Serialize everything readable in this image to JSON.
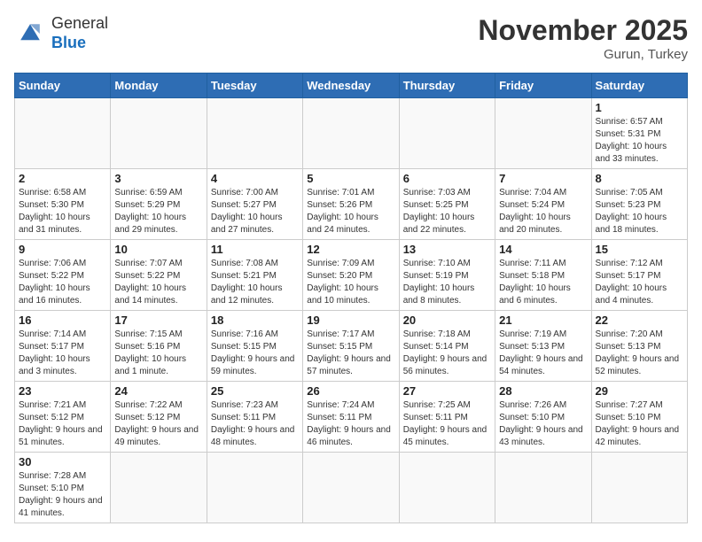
{
  "logo": {
    "general": "General",
    "blue": "Blue"
  },
  "title": "November 2025",
  "location": "Gurun, Turkey",
  "days_of_week": [
    "Sunday",
    "Monday",
    "Tuesday",
    "Wednesday",
    "Thursday",
    "Friday",
    "Saturday"
  ],
  "weeks": [
    [
      {
        "day": "",
        "info": ""
      },
      {
        "day": "",
        "info": ""
      },
      {
        "day": "",
        "info": ""
      },
      {
        "day": "",
        "info": ""
      },
      {
        "day": "",
        "info": ""
      },
      {
        "day": "",
        "info": ""
      },
      {
        "day": "1",
        "info": "Sunrise: 6:57 AM\nSunset: 5:31 PM\nDaylight: 10 hours and 33 minutes."
      }
    ],
    [
      {
        "day": "2",
        "info": "Sunrise: 6:58 AM\nSunset: 5:30 PM\nDaylight: 10 hours and 31 minutes."
      },
      {
        "day": "3",
        "info": "Sunrise: 6:59 AM\nSunset: 5:29 PM\nDaylight: 10 hours and 29 minutes."
      },
      {
        "day": "4",
        "info": "Sunrise: 7:00 AM\nSunset: 5:27 PM\nDaylight: 10 hours and 27 minutes."
      },
      {
        "day": "5",
        "info": "Sunrise: 7:01 AM\nSunset: 5:26 PM\nDaylight: 10 hours and 24 minutes."
      },
      {
        "day": "6",
        "info": "Sunrise: 7:03 AM\nSunset: 5:25 PM\nDaylight: 10 hours and 22 minutes."
      },
      {
        "day": "7",
        "info": "Sunrise: 7:04 AM\nSunset: 5:24 PM\nDaylight: 10 hours and 20 minutes."
      },
      {
        "day": "8",
        "info": "Sunrise: 7:05 AM\nSunset: 5:23 PM\nDaylight: 10 hours and 18 minutes."
      }
    ],
    [
      {
        "day": "9",
        "info": "Sunrise: 7:06 AM\nSunset: 5:22 PM\nDaylight: 10 hours and 16 minutes."
      },
      {
        "day": "10",
        "info": "Sunrise: 7:07 AM\nSunset: 5:22 PM\nDaylight: 10 hours and 14 minutes."
      },
      {
        "day": "11",
        "info": "Sunrise: 7:08 AM\nSunset: 5:21 PM\nDaylight: 10 hours and 12 minutes."
      },
      {
        "day": "12",
        "info": "Sunrise: 7:09 AM\nSunset: 5:20 PM\nDaylight: 10 hours and 10 minutes."
      },
      {
        "day": "13",
        "info": "Sunrise: 7:10 AM\nSunset: 5:19 PM\nDaylight: 10 hours and 8 minutes."
      },
      {
        "day": "14",
        "info": "Sunrise: 7:11 AM\nSunset: 5:18 PM\nDaylight: 10 hours and 6 minutes."
      },
      {
        "day": "15",
        "info": "Sunrise: 7:12 AM\nSunset: 5:17 PM\nDaylight: 10 hours and 4 minutes."
      }
    ],
    [
      {
        "day": "16",
        "info": "Sunrise: 7:14 AM\nSunset: 5:17 PM\nDaylight: 10 hours and 3 minutes."
      },
      {
        "day": "17",
        "info": "Sunrise: 7:15 AM\nSunset: 5:16 PM\nDaylight: 10 hours and 1 minute."
      },
      {
        "day": "18",
        "info": "Sunrise: 7:16 AM\nSunset: 5:15 PM\nDaylight: 9 hours and 59 minutes."
      },
      {
        "day": "19",
        "info": "Sunrise: 7:17 AM\nSunset: 5:15 PM\nDaylight: 9 hours and 57 minutes."
      },
      {
        "day": "20",
        "info": "Sunrise: 7:18 AM\nSunset: 5:14 PM\nDaylight: 9 hours and 56 minutes."
      },
      {
        "day": "21",
        "info": "Sunrise: 7:19 AM\nSunset: 5:13 PM\nDaylight: 9 hours and 54 minutes."
      },
      {
        "day": "22",
        "info": "Sunrise: 7:20 AM\nSunset: 5:13 PM\nDaylight: 9 hours and 52 minutes."
      }
    ],
    [
      {
        "day": "23",
        "info": "Sunrise: 7:21 AM\nSunset: 5:12 PM\nDaylight: 9 hours and 51 minutes."
      },
      {
        "day": "24",
        "info": "Sunrise: 7:22 AM\nSunset: 5:12 PM\nDaylight: 9 hours and 49 minutes."
      },
      {
        "day": "25",
        "info": "Sunrise: 7:23 AM\nSunset: 5:11 PM\nDaylight: 9 hours and 48 minutes."
      },
      {
        "day": "26",
        "info": "Sunrise: 7:24 AM\nSunset: 5:11 PM\nDaylight: 9 hours and 46 minutes."
      },
      {
        "day": "27",
        "info": "Sunrise: 7:25 AM\nSunset: 5:11 PM\nDaylight: 9 hours and 45 minutes."
      },
      {
        "day": "28",
        "info": "Sunrise: 7:26 AM\nSunset: 5:10 PM\nDaylight: 9 hours and 43 minutes."
      },
      {
        "day": "29",
        "info": "Sunrise: 7:27 AM\nSunset: 5:10 PM\nDaylight: 9 hours and 42 minutes."
      }
    ],
    [
      {
        "day": "30",
        "info": "Sunrise: 7:28 AM\nSunset: 5:10 PM\nDaylight: 9 hours and 41 minutes."
      },
      {
        "day": "",
        "info": ""
      },
      {
        "day": "",
        "info": ""
      },
      {
        "day": "",
        "info": ""
      },
      {
        "day": "",
        "info": ""
      },
      {
        "day": "",
        "info": ""
      },
      {
        "day": "",
        "info": ""
      }
    ]
  ]
}
